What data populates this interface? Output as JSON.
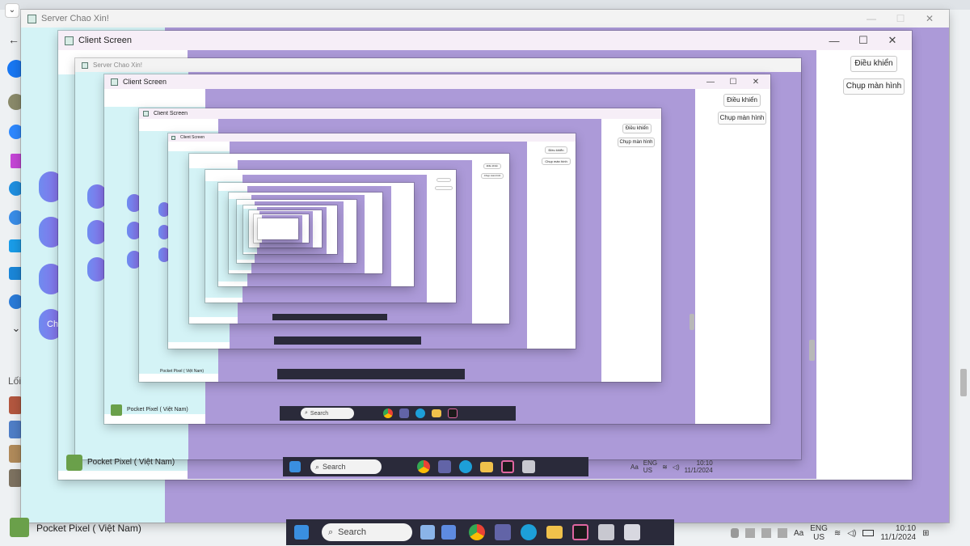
{
  "outer_window": {
    "title": "Server Chao Xin!",
    "controls": [
      "—",
      "☐",
      "✕"
    ]
  },
  "client_window": {
    "title": "Client Screen",
    "controls": [
      "—",
      "☐",
      "✕"
    ],
    "buttons": {
      "control_label": "Điều khiển",
      "screenshot_label": "Chụp màn hình"
    }
  },
  "sidebar": {
    "section_label": "Lối",
    "chat_label": "Ch",
    "page_name": "Pocket Pixel ( Việt Nam)",
    "page_name_nested": "Pocket Pixel ( Việt Nam)"
  },
  "taskbar": {
    "search_placeholder": "Search",
    "language": "ENG",
    "region": "US",
    "time": "10:10",
    "date": "11/1/2024",
    "font_label": "Aa"
  },
  "colors": {
    "lavender": "#ac9ad8",
    "cyan": "#d4f3f6",
    "window_bg": "#ffffff",
    "client_titlebar": "#f6eef7"
  },
  "icons": [
    "facebook-icon",
    "search-icon",
    "windows-start-icon",
    "chrome-icon",
    "edge-icon",
    "teams-icon",
    "folder-icon",
    "wifi-icon",
    "volume-icon",
    "battery-icon"
  ]
}
